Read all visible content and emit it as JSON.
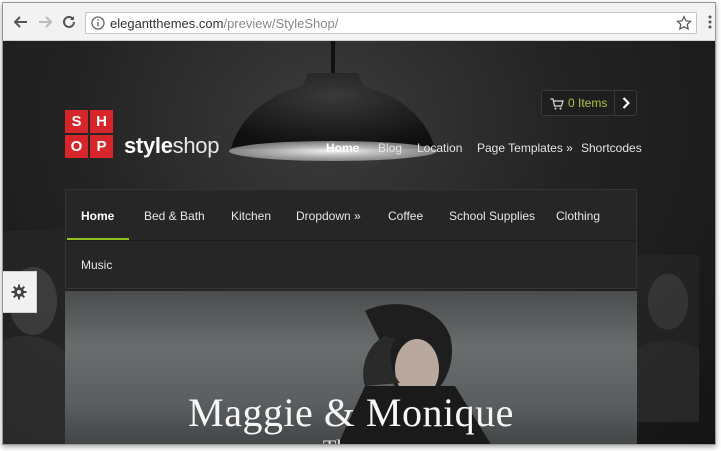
{
  "browser": {
    "url_domain": "elegantthemes.com",
    "url_path": "/preview/StyleShop/"
  },
  "logo": {
    "letters": [
      "S",
      "H",
      "O",
      "P"
    ]
  },
  "brand": {
    "bold": "style",
    "light": "shop"
  },
  "cart": {
    "label": "0 Items"
  },
  "top_nav": [
    {
      "label": "Home"
    },
    {
      "label": "Blog"
    },
    {
      "label": "Location"
    },
    {
      "label": "Page Templates »"
    },
    {
      "label": "Shortcodes"
    }
  ],
  "main_nav": [
    {
      "label": "Home"
    },
    {
      "label": "Bed & Bath"
    },
    {
      "label": "Kitchen"
    },
    {
      "label": "Dropdown »"
    },
    {
      "label": "Coffee"
    },
    {
      "label": "School Supplies"
    },
    {
      "label": "Clothing"
    },
    {
      "label": "Music"
    }
  ],
  "hero": {
    "title": "Maggie & Monique",
    "subtitle": "The ... "
  },
  "colors": {
    "accent_green": "#8fc21e",
    "logo_red": "#d6262b",
    "cart_text": "#a8c545"
  },
  "icons": [
    "back-arrow-icon",
    "forward-arrow-icon",
    "reload-icon",
    "info-icon",
    "star-icon",
    "menu-dots-icon",
    "cart-icon",
    "chevron-right-icon",
    "gear-icon"
  ]
}
